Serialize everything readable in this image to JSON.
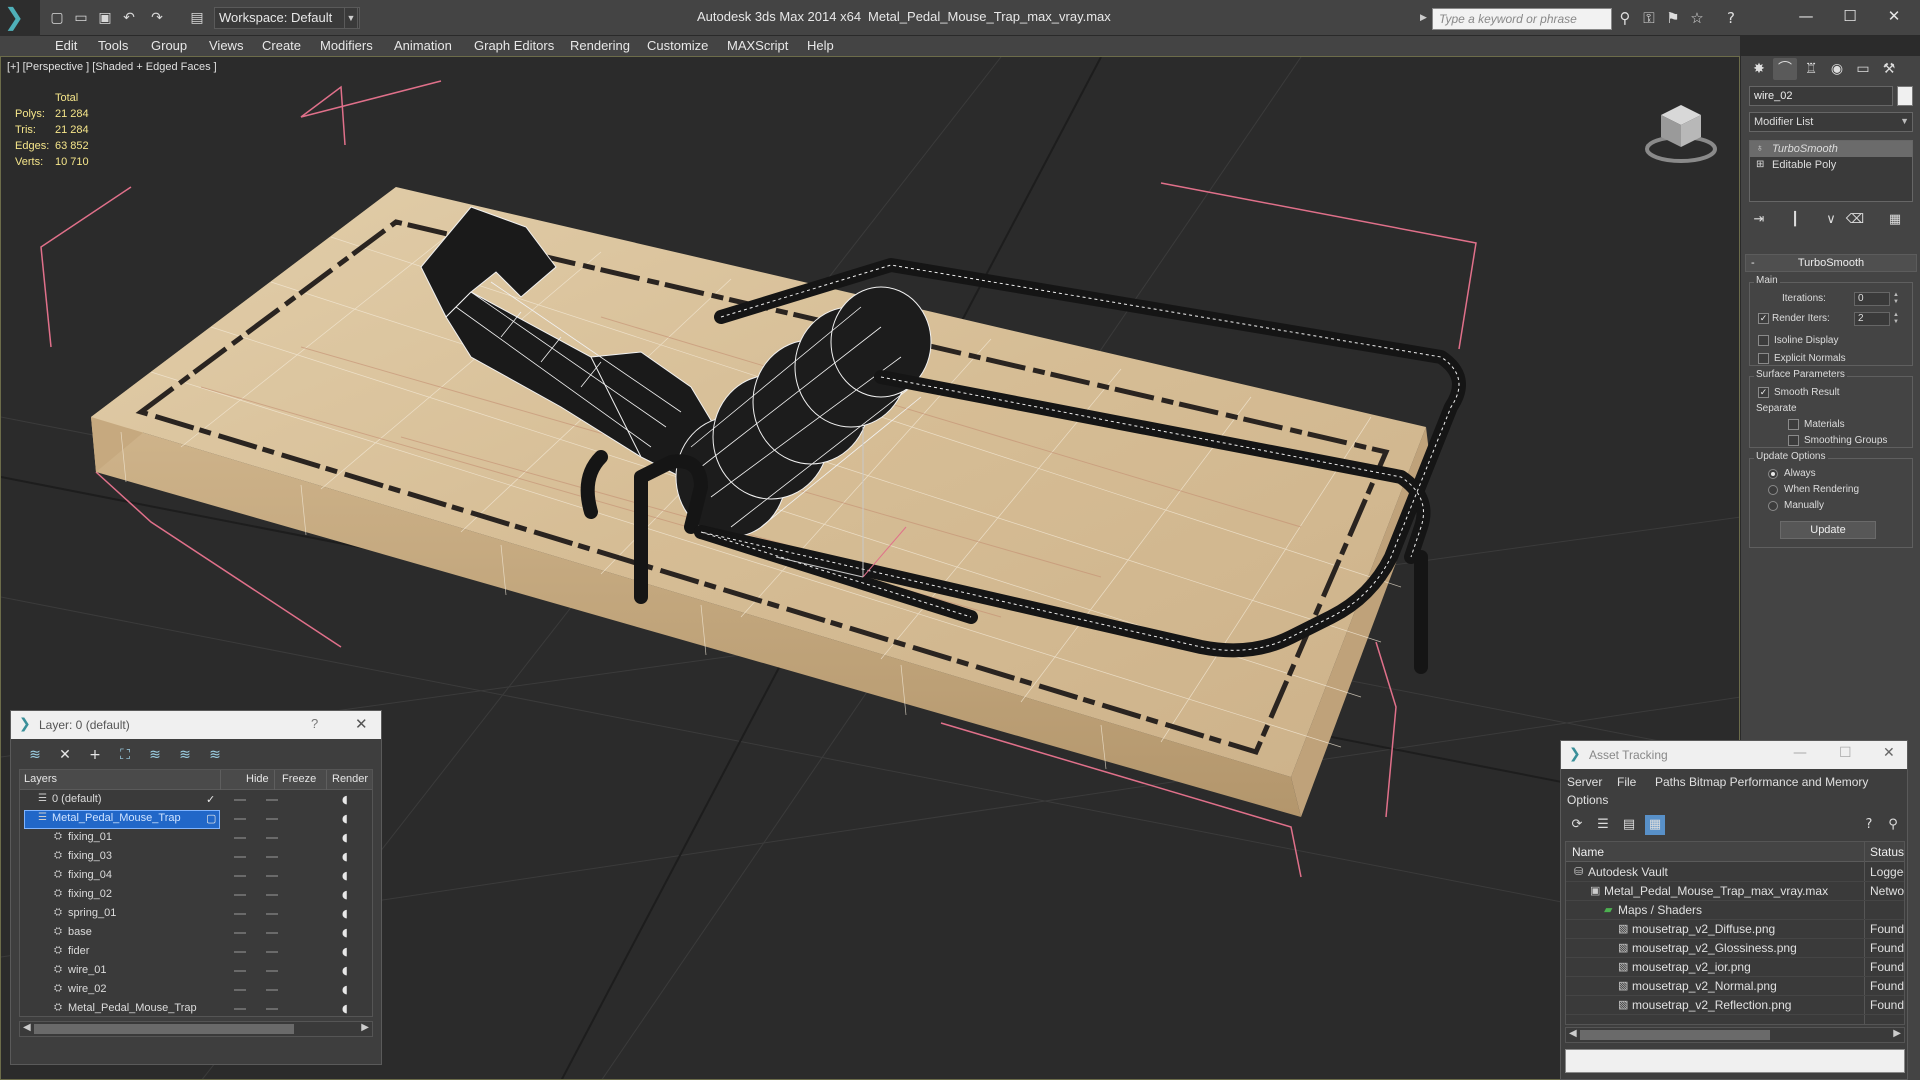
{
  "app": {
    "title": "Autodesk 3ds Max  2014 x64",
    "file_name": "Metal_Pedal_Mouse_Trap_max_vray.max"
  },
  "toolbar": {
    "workspace_label": "Workspace: Default",
    "search_placeholder": "Type a keyword or phrase"
  },
  "menu": [
    "Edit",
    "Tools",
    "Group",
    "Views",
    "Create",
    "Modifiers",
    "Animation",
    "Graph Editors",
    "Rendering",
    "Customize",
    "MAXScript",
    "Help"
  ],
  "viewport": {
    "label": "[+] [Perspective ] [Shaded + Edged Faces ]",
    "stats_header": "Total",
    "stats": [
      {
        "key": "Polys:",
        "value": "21 284"
      },
      {
        "key": "Tris:",
        "value": "21 284"
      },
      {
        "key": "Edges:",
        "value": "63 852"
      },
      {
        "key": "Verts:",
        "value": "10 710"
      }
    ],
    "colors": {
      "wood_light": "#d9c4a0",
      "wood_dark": "#b89a72",
      "wire": "#1a1a1a",
      "bbox": "#e0708a",
      "grid": "#3a3a3a"
    }
  },
  "command_panel": {
    "object_name": "wire_02",
    "modifier_list": "Modifier List",
    "stack": [
      {
        "label": "TurboSmooth",
        "selected": true
      },
      {
        "label": "Editable Poly",
        "selected": false
      }
    ],
    "rollout_title": "TurboSmooth",
    "main_group": "Main",
    "iterations_label": "Iterations:",
    "iterations_value": "0",
    "render_iters_label": "Render Iters:",
    "render_iters_value": "2",
    "isoline_label": "Isoline Display",
    "explicit_normals_label": "Explicit Normals",
    "surface_group": "Surface Parameters",
    "smooth_result_label": "Smooth Result",
    "separate_label": "Separate",
    "materials_label": "Materials",
    "smoothing_groups_label": "Smoothing Groups",
    "update_group": "Update Options",
    "always_label": "Always",
    "when_rendering_label": "When Rendering",
    "manually_label": "Manually",
    "update_button": "Update"
  },
  "layer_window": {
    "title": "Layer: 0 (default)",
    "help": "?",
    "columns": [
      "Layers",
      "Hide",
      "Freeze",
      "Render"
    ],
    "rows": [
      {
        "name": "0 (default)",
        "indent": 1,
        "selected": false,
        "active": true
      },
      {
        "name": "Metal_Pedal_Mouse_Trap",
        "indent": 1,
        "selected": true,
        "active": false
      },
      {
        "name": "fixing_01",
        "indent": 2,
        "selected": false,
        "active": false
      },
      {
        "name": "fixing_03",
        "indent": 2,
        "selected": false,
        "active": false
      },
      {
        "name": "fixing_04",
        "indent": 2,
        "selected": false,
        "active": false
      },
      {
        "name": "fixing_02",
        "indent": 2,
        "selected": false,
        "active": false
      },
      {
        "name": "spring_01",
        "indent": 2,
        "selected": false,
        "active": false
      },
      {
        "name": "base",
        "indent": 2,
        "selected": false,
        "active": false
      },
      {
        "name": "fider",
        "indent": 2,
        "selected": false,
        "active": false
      },
      {
        "name": "wire_01",
        "indent": 2,
        "selected": false,
        "active": false
      },
      {
        "name": "wire_02",
        "indent": 2,
        "selected": false,
        "active": false
      },
      {
        "name": "Metal_Pedal_Mouse_Trap",
        "indent": 2,
        "selected": false,
        "active": false
      }
    ]
  },
  "asset_window": {
    "title": "Asset Tracking",
    "menu_row1": [
      "Server",
      "File",
      "Paths",
      "Bitmap Performance and Memory"
    ],
    "menu_row2": [
      "Options"
    ],
    "columns": [
      "Name",
      "Status"
    ],
    "rows": [
      {
        "name": "Autodesk Vault",
        "indent": 1,
        "icon": "vault",
        "status": "Logged"
      },
      {
        "name": "Metal_Pedal_Mouse_Trap_max_vray.max",
        "indent": 2,
        "icon": "max-file",
        "status": "Networ"
      },
      {
        "name": "Maps / Shaders",
        "indent": 3,
        "icon": "folder",
        "status": ""
      },
      {
        "name": "mousetrap_v2_Diffuse.png",
        "indent": 4,
        "icon": "image",
        "status": "Found"
      },
      {
        "name": "mousetrap_v2_Glossiness.png",
        "indent": 4,
        "icon": "image",
        "status": "Found"
      },
      {
        "name": "mousetrap_v2_ior.png",
        "indent": 4,
        "icon": "image",
        "status": "Found"
      },
      {
        "name": "mousetrap_v2_Normal.png",
        "indent": 4,
        "icon": "image",
        "status": "Found"
      },
      {
        "name": "mousetrap_v2_Reflection.png",
        "indent": 4,
        "icon": "image",
        "status": "Found"
      }
    ]
  }
}
